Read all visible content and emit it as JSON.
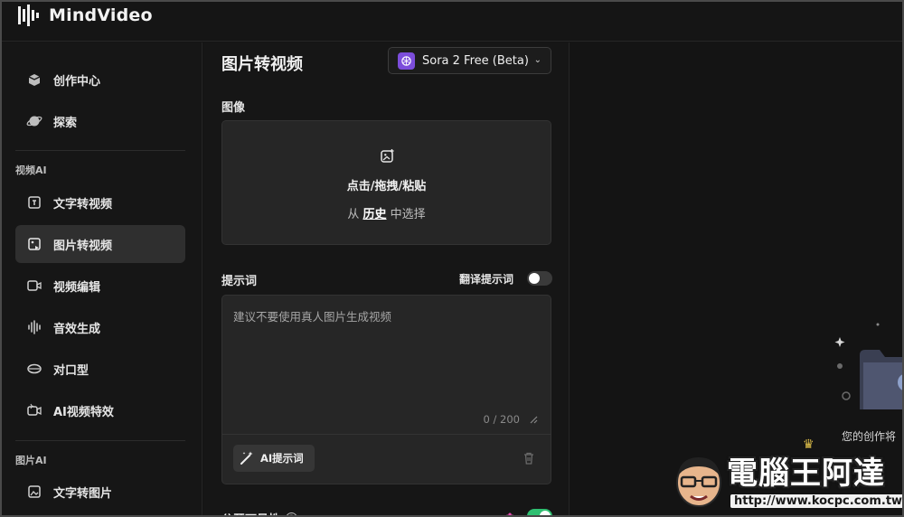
{
  "app": {
    "name": "MindVideo"
  },
  "sidebar": {
    "top_items": [
      {
        "label": "创作中心",
        "icon": "box-icon"
      },
      {
        "label": "探索",
        "icon": "planet-icon"
      }
    ],
    "section_video": "视频AI",
    "video_items": [
      {
        "label": "文字转视频",
        "icon": "text-video-icon"
      },
      {
        "label": "图片转视频",
        "icon": "image-video-icon",
        "active": true
      },
      {
        "label": "视频编辑",
        "icon": "video-edit-icon"
      },
      {
        "label": "音效生成",
        "icon": "audio-wave-icon"
      },
      {
        "label": "对口型",
        "icon": "lips-icon"
      },
      {
        "label": "AI视频特效",
        "icon": "video-effects-icon"
      }
    ],
    "section_image": "图片AI",
    "image_items": [
      {
        "label": "文字转图片",
        "icon": "text-image-icon"
      }
    ]
  },
  "main": {
    "title": "图片转视频",
    "model": "Sora 2 Free (Beta)",
    "image_label": "图像",
    "upload": {
      "primary": "点击/拖拽/粘贴",
      "prefix": "从",
      "history": "历史",
      "suffix": "中选择"
    },
    "prompt_label": "提示词",
    "translate_label": "翻译提示词",
    "translate_on": false,
    "prompt_placeholder": "建议不要使用真人图片生成视频",
    "counter": "0 / 200",
    "ai_button": "AI提示词",
    "public_label": "公开可见性",
    "public_on": true
  },
  "right": {
    "empty_text": "您的创作将"
  },
  "watermark": {
    "title": "電腦王阿達",
    "url": "http://www.kocpc.com.tw"
  },
  "colors": {
    "background": "#141414",
    "panel": "#161616",
    "accent_model": "#7c4ddb",
    "toggle_on": "#2fbf71"
  }
}
